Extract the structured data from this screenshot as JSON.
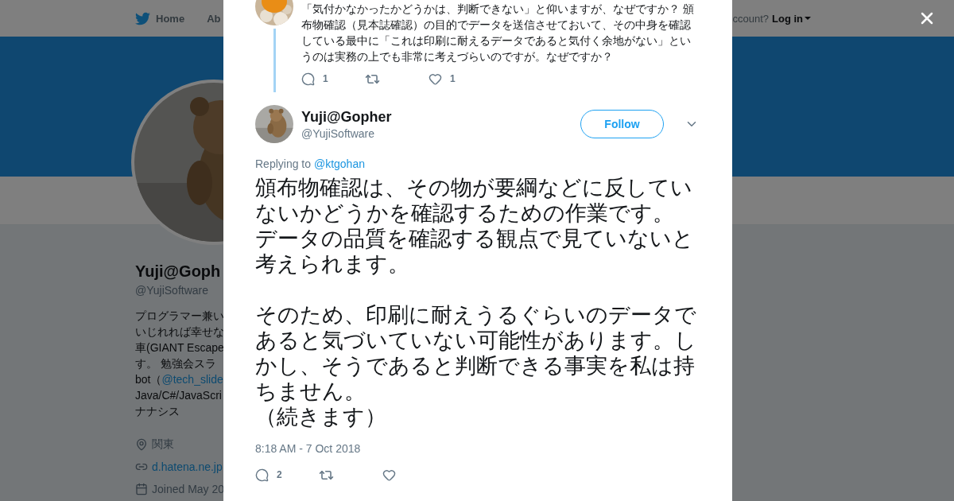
{
  "background": {
    "nav": {
      "items": [
        {
          "label": "Home",
          "kind": "home"
        },
        {
          "label": "Ab",
          "kind": "link"
        }
      ],
      "account_prompt": "ccount?",
      "login": "Log in"
    },
    "profile": {
      "name": "Yuji@Goph",
      "handle": "@YujiSoftware",
      "bio_lines": [
        {
          "text": "プログラマー兼い"
        },
        {
          "text": "いじれれば幸せな"
        },
        {
          "text": "車(GIANT Escape"
        },
        {
          "text": "す。 勉強会スラ"
        },
        {
          "text": "bot（",
          "link": "@tech_slide"
        },
        {
          "text": "Java/C#/JavaScri"
        },
        {
          "text": "ナナシス"
        }
      ],
      "location": "関東",
      "url": "d.hatena.ne.jp",
      "joined": "Joined May 20"
    }
  },
  "modal": {
    "previous_tweet": {
      "text": "「気付かなかったかどうかは、判断できない」と仰いますが、なぜですか？ 頒布物確認（見本誌確認）の目的でデータを送信させておいて、その中身を確認している最中に「これは印刷に耐えるデータであると気付く余地がない」というのは実務の上でも非常に考えづらいのですが。なぜですか？",
      "replies": "1",
      "likes": "1"
    },
    "tweet": {
      "name": "Yuji@Gopher",
      "handle": "@YujiSoftware",
      "follow": "Follow",
      "replying_label": "Replying to",
      "replying_to": "@ktgohan",
      "blocks": [
        {
          "lines": [
            "頒布物確認は、その物が要綱などに反していないかどうかを確認するための作業です。",
            "データの品質を確認する観点で見ていないと考えられます。"
          ]
        },
        {
          "lines": [
            "そのため、印刷に耐えうるぐらいのデータであると気づいていない可能性があります。しかし、そうであると判断できる事実を私は持ちません。",
            "（続きます）"
          ]
        }
      ],
      "time": "8:18 AM - 7 Oct 2018",
      "replies": "2"
    }
  }
}
